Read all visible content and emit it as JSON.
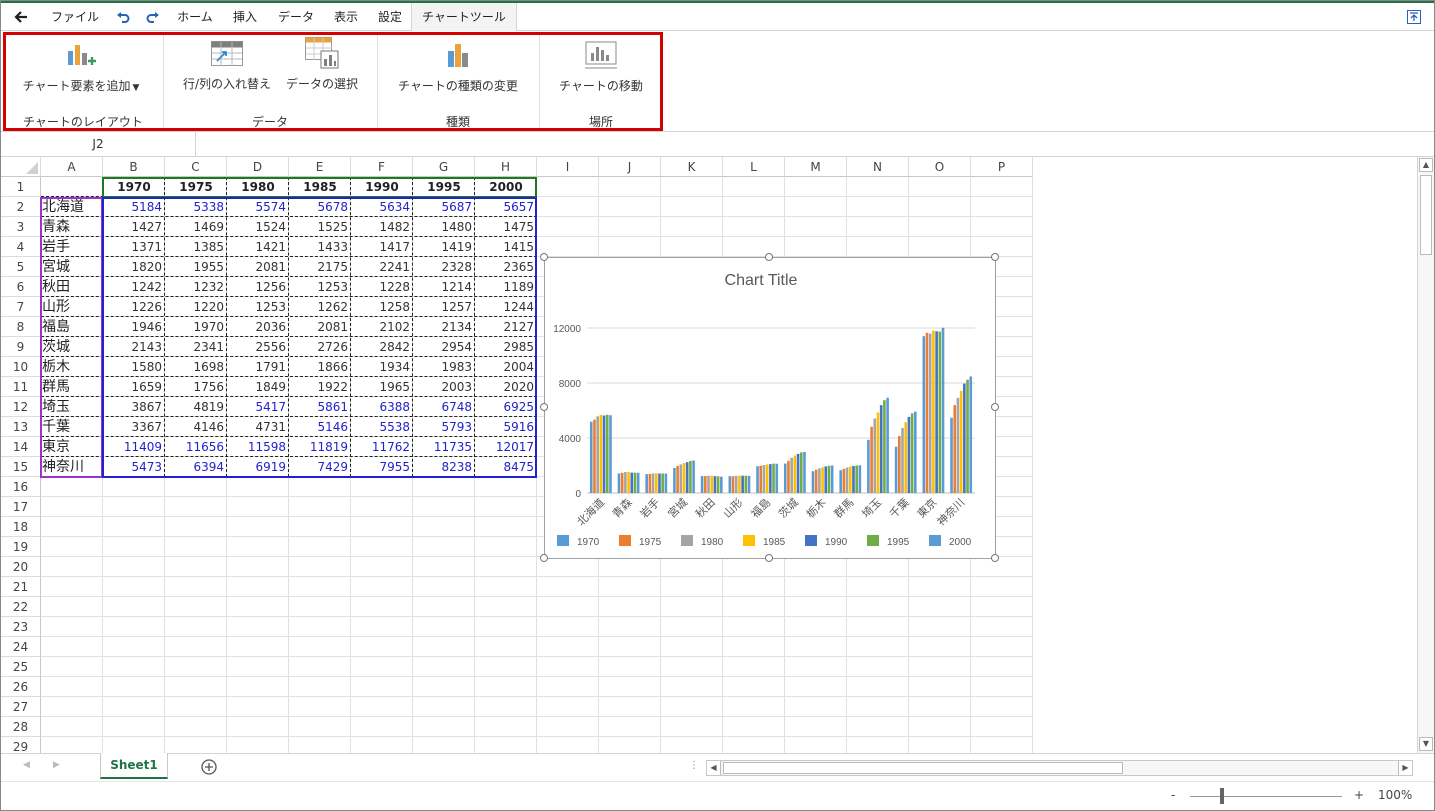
{
  "menubar": {
    "back_icon": "back-arrow-icon",
    "items": [
      "ファイル",
      "ホーム",
      "挿入",
      "データ",
      "表示",
      "設定",
      "チャートツール"
    ],
    "undo_icon": "undo-icon",
    "redo_icon": "redo-icon",
    "collapse_icon": "collapse-ribbon-icon"
  },
  "ribbon": {
    "add_element": "チャート要素を追加",
    "switch_row_col": "行/列の入れ替え",
    "select_data": "データの選択",
    "change_type": "チャートの種類の変更",
    "move_chart": "チャートの移動",
    "group_layout": "チャートのレイアウト",
    "group_data": "データ",
    "group_type": "種類",
    "group_location": "場所"
  },
  "name_box": "J2",
  "columns": [
    "A",
    "B",
    "C",
    "D",
    "E",
    "F",
    "G",
    "H",
    "I",
    "J",
    "K",
    "L",
    "M",
    "N",
    "O",
    "P"
  ],
  "rows": [
    "1",
    "2",
    "3",
    "4",
    "5",
    "6",
    "7",
    "8",
    "9",
    "10",
    "11",
    "12",
    "13",
    "14",
    "15",
    "16",
    "17",
    "18",
    "19",
    "20",
    "21",
    "22",
    "23",
    "24",
    "25",
    "26",
    "27",
    "28",
    "29"
  ],
  "sheet": {
    "years": [
      "1970",
      "1975",
      "1980",
      "1985",
      "1990",
      "1995",
      "2000"
    ],
    "prefectures": [
      "北海道",
      "青森",
      "岩手",
      "宮城",
      "秋田",
      "山形",
      "福島",
      "茨城",
      "栃木",
      "群馬",
      "埼玉",
      "千葉",
      "東京",
      "神奈川"
    ],
    "values": [
      [
        5184,
        5338,
        5574,
        5678,
        5634,
        5687,
        5657
      ],
      [
        1427,
        1469,
        1524,
        1525,
        1482,
        1480,
        1475
      ],
      [
        1371,
        1385,
        1421,
        1433,
        1417,
        1419,
        1415
      ],
      [
        1820,
        1955,
        2081,
        2175,
        2241,
        2328,
        2365
      ],
      [
        1242,
        1232,
        1256,
        1253,
        1228,
        1214,
        1189
      ],
      [
        1226,
        1220,
        1253,
        1262,
        1258,
        1257,
        1244
      ],
      [
        1946,
        1970,
        2036,
        2081,
        2102,
        2134,
        2127
      ],
      [
        2143,
        2341,
        2556,
        2726,
        2842,
        2954,
        2985
      ],
      [
        1580,
        1698,
        1791,
        1866,
        1934,
        1983,
        2004
      ],
      [
        1659,
        1756,
        1849,
        1922,
        1965,
        2003,
        2020
      ],
      [
        3867,
        4819,
        5417,
        5861,
        6388,
        6748,
        6925
      ],
      [
        3367,
        4146,
        4731,
        5146,
        5538,
        5793,
        5916
      ],
      [
        11409,
        11656,
        11598,
        11819,
        11762,
        11735,
        12017
      ],
      [
        5473,
        6394,
        6919,
        7429,
        7955,
        8238,
        8475
      ]
    ]
  },
  "chart_data": {
    "type": "bar",
    "title": "Chart Title",
    "categories": [
      "北海道",
      "青森",
      "岩手",
      "宮城",
      "秋田",
      "山形",
      "福島",
      "茨城",
      "栃木",
      "群馬",
      "埼玉",
      "千葉",
      "東京",
      "神奈川"
    ],
    "ylim": [
      0,
      12000
    ],
    "yticks": [
      "0",
      "4000",
      "8000",
      "12000"
    ],
    "ytick_values": [
      0,
      4000,
      8000,
      12000
    ],
    "legend_position": "bottom",
    "grid": true,
    "series": [
      {
        "name": "1970",
        "color": "#5b9bd5",
        "values": [
          5184,
          1427,
          1371,
          1820,
          1242,
          1226,
          1946,
          2143,
          1580,
          1659,
          3867,
          3367,
          11409,
          5473
        ]
      },
      {
        "name": "1975",
        "color": "#ed7d31",
        "values": [
          5338,
          1469,
          1385,
          1955,
          1232,
          1220,
          1970,
          2341,
          1698,
          1756,
          4819,
          4146,
          11656,
          6394
        ]
      },
      {
        "name": "1980",
        "color": "#a5a5a5",
        "values": [
          5574,
          1524,
          1421,
          2081,
          1256,
          1253,
          2036,
          2556,
          1791,
          1849,
          5417,
          4731,
          11598,
          6919
        ]
      },
      {
        "name": "1985",
        "color": "#ffc000",
        "values": [
          5678,
          1525,
          1433,
          2175,
          1253,
          1262,
          2081,
          2726,
          1866,
          1922,
          5861,
          5146,
          11819,
          7429
        ]
      },
      {
        "name": "1990",
        "color": "#4472c4",
        "values": [
          5634,
          1482,
          1417,
          2241,
          1228,
          1258,
          2102,
          2842,
          1934,
          1965,
          6388,
          5538,
          11762,
          7955
        ]
      },
      {
        "name": "1995",
        "color": "#70ad47",
        "values": [
          5687,
          1480,
          1419,
          2328,
          1214,
          1257,
          2134,
          2954,
          1983,
          2003,
          6748,
          5793,
          11735,
          8238
        ]
      },
      {
        "name": "2000",
        "color": "#5b9bd5",
        "values": [
          5657,
          1475,
          1415,
          2365,
          1189,
          1244,
          2127,
          2985,
          2004,
          2020,
          6925,
          5916,
          12017,
          8475
        ]
      }
    ]
  },
  "sheet_tab": "Sheet1",
  "add_sheet_icon": "add-sheet-icon",
  "zoom": {
    "minus": "-",
    "plus": "+",
    "level": "100%"
  }
}
